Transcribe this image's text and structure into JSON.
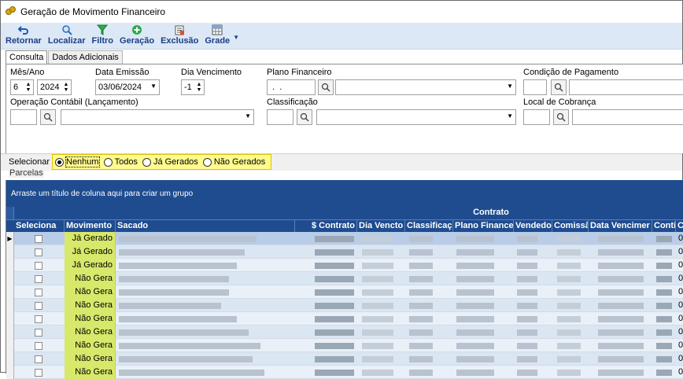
{
  "window": {
    "title": "Geração de Movimento Financeiro"
  },
  "toolbar": {
    "buttons": [
      {
        "label": "Retornar",
        "icon": "undo-icon"
      },
      {
        "label": "Localizar",
        "icon": "search-icon"
      },
      {
        "label": "Filtro",
        "icon": "filter-icon"
      },
      {
        "label": "Geração",
        "icon": "add-icon"
      },
      {
        "label": "Exclusão",
        "icon": "delete-icon"
      },
      {
        "label": "Grade",
        "icon": "grid-icon"
      }
    ]
  },
  "tabs": [
    {
      "label": "Consulta"
    },
    {
      "label": "Dados Adicionais"
    }
  ],
  "filters": {
    "mes_ano": {
      "label": "Mês/Ano",
      "month": "6",
      "year": "2024"
    },
    "data_emissao": {
      "label": "Data Emissão",
      "value": "03/06/2024"
    },
    "dia_vencimento": {
      "label": "Dia Vencimento",
      "value": "-1"
    },
    "plano_financeiro": {
      "label": "Plano Financeiro",
      "code": " .  ."
    },
    "condicao_pagamento": {
      "label": "Condição de Pagamento"
    },
    "operacao_contabil": {
      "label": "Operação Contábil (Lançamento)"
    },
    "classificacao": {
      "label": "Classificação"
    },
    "local_cobranca": {
      "label": "Local de Cobrança"
    }
  },
  "selecionar": {
    "label": "Selecionar",
    "options": [
      "Nenhum",
      "Todos",
      "Já Gerados",
      "Não Gerados"
    ],
    "selected": "Nenhum"
  },
  "parcelas": {
    "label": "Parcelas",
    "group_hint": "Arraste um título de coluna aqui para criar um grupo",
    "band": "Contrato",
    "columns": [
      "Seleciona",
      "Movimento",
      "Sacado",
      "$ Contrato",
      "Dia Vencto",
      "Classificaç",
      "Plano Finance",
      "Vendedo",
      "Comissã",
      "Data Vencimer",
      "Conti",
      "C"
    ],
    "rows": [
      {
        "movimento": "Já Gerado",
        "last": "0"
      },
      {
        "movimento": "Já Gerado",
        "last": "0"
      },
      {
        "movimento": "Já Gerado",
        "last": "0"
      },
      {
        "movimento": "Não Gera",
        "last": "0"
      },
      {
        "movimento": "Não Gera",
        "last": "0"
      },
      {
        "movimento": "Não Gera",
        "last": "0"
      },
      {
        "movimento": "Não Gera",
        "last": "0"
      },
      {
        "movimento": "Não Gera",
        "last": "0"
      },
      {
        "movimento": "Não Gera",
        "last": "0"
      },
      {
        "movimento": "Não Gera",
        "last": "0"
      },
      {
        "movimento": "Não Gera",
        "last": "0"
      }
    ]
  }
}
